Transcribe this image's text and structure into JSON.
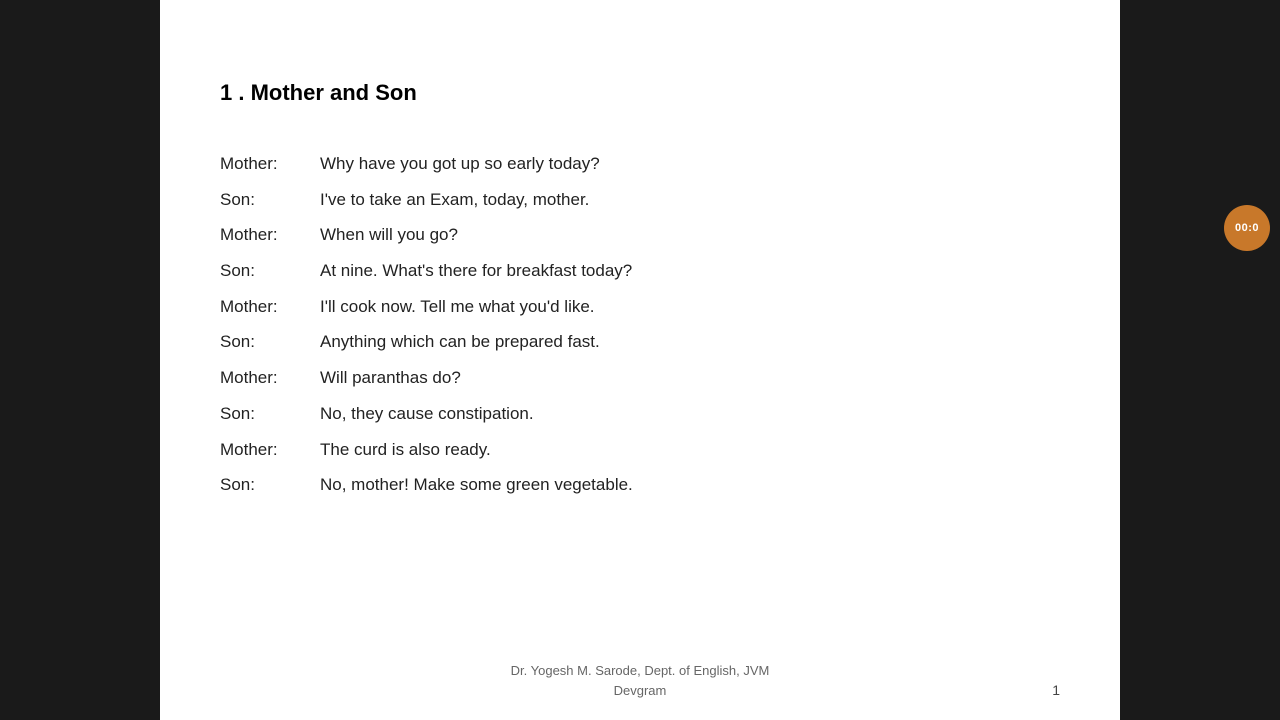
{
  "slide": {
    "title": "1 . Mother and Son",
    "dialogues": [
      {
        "speaker": "Mother:",
        "speech": "Why have you got up so early today?"
      },
      {
        "speaker": "Son:",
        "speech": "I've to take an Exam, today, mother."
      },
      {
        "speaker": "Mother:",
        "speech": "When will you go?"
      },
      {
        "speaker": "Son:",
        "speech": "At nine. What's there for breakfast today?"
      },
      {
        "speaker": "Mother:",
        "speech": "I'll cook now. Tell me what you'd like."
      },
      {
        "speaker": "Son:",
        "speech": "Anything which can be prepared fast."
      },
      {
        "speaker": "Mother:",
        "speech": "Will paranthas  do?"
      },
      {
        "speaker": "Son:",
        "speech": "No, they cause constipation."
      },
      {
        "speaker": "Mother:",
        "speech": "The curd is also ready."
      },
      {
        "speaker": "Son:",
        "speech": "No, mother! Make some green vegetable."
      }
    ],
    "footer_line1": "Dr. Yogesh M. Sarode, Dept. of English, JVM",
    "footer_line2": "Devgram",
    "slide_number": "1"
  },
  "timer": {
    "label": "00:0",
    "colors": {
      "badge": "#c8782a"
    }
  }
}
